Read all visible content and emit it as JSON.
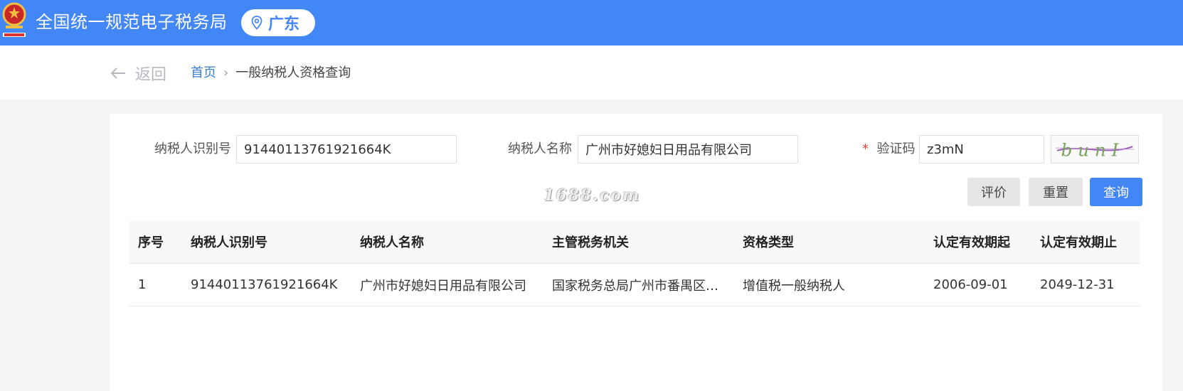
{
  "header": {
    "emblem_icon": "national-emblem-icon",
    "title": "全国统一规范电子税务局",
    "region": "广东",
    "region_icon": "location-pin-icon",
    "bar_color": "#4386f5"
  },
  "nav": {
    "back_label": "返回",
    "back_icon": "arrow-left-icon",
    "breadcrumb": {
      "home": "首页",
      "separator": "›",
      "current": "一般纳税人资格查询"
    }
  },
  "form": {
    "taxpayer_id": {
      "label": "纳税人识别号",
      "value": "91440113761921664K"
    },
    "taxpayer_name": {
      "label": "纳税人名称",
      "value": "广州市好媳妇日用品有限公司"
    },
    "captcha": {
      "required_mark": "*",
      "label": "验证码",
      "value": "z3mN",
      "image_text": "b u n I"
    }
  },
  "buttons": {
    "evaluate": "评价",
    "reset": "重置",
    "query": "查询"
  },
  "watermark": "1688.com",
  "table": {
    "columns": [
      "序号",
      "纳税人识别号",
      "纳税人名称",
      "主管税务机关",
      "资格类型",
      "认定有效期起",
      "认定有效期止"
    ],
    "rows": [
      [
        "1",
        "91440113761921664K",
        "广州市好媳妇日用品有限公司",
        "国家税务总局广州市番禺区税...",
        "增值税一般纳税人",
        "2006-09-01",
        "2049-12-31"
      ]
    ]
  }
}
